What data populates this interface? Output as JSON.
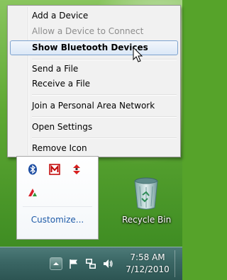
{
  "menu": {
    "items": [
      {
        "label": "Add a Device",
        "state": "normal"
      },
      {
        "label": "Allow a Device to Connect",
        "state": "disabled"
      },
      {
        "label": "Show Bluetooth Devices",
        "state": "highlighted"
      },
      {
        "label": "Send a File",
        "state": "normal"
      },
      {
        "label": "Receive a File",
        "state": "normal"
      },
      {
        "label": "Join a Personal Area Network",
        "state": "normal"
      },
      {
        "label": "Open Settings",
        "state": "normal"
      },
      {
        "label": "Remove Icon",
        "state": "normal"
      }
    ]
  },
  "tray_panel": {
    "icons": [
      "bluetooth-icon",
      "mcafee-icon",
      "red-diamond-icon",
      "red-green-triangle-icon"
    ],
    "customize_label": "Customize..."
  },
  "desktop": {
    "recycle_bin_label": "Recycle Bin"
  },
  "taskbar": {
    "icons": [
      "show-hidden-icons",
      "action-center-flag-icon",
      "network-icon",
      "volume-icon"
    ],
    "time": "7:58 AM",
    "date": "7/12/2010"
  },
  "colors": {
    "menu_highlight_border": "#7da2ce",
    "link": "#1e5aa8",
    "taskbar": "#3a6664"
  }
}
